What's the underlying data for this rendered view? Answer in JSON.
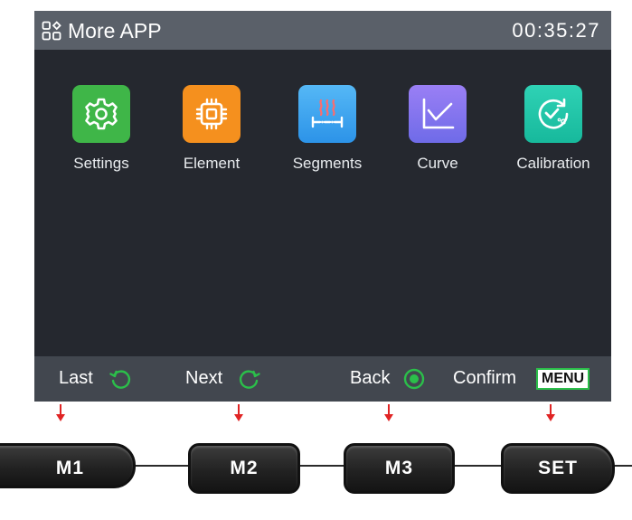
{
  "header": {
    "title": "More APP",
    "clock": "00:35:27",
    "title_icon": "app-grid-icon"
  },
  "apps": [
    {
      "label": "Settings",
      "icon": "gear-icon",
      "color": "#3fb648"
    },
    {
      "label": "Element",
      "icon": "chip-icon",
      "color": "#f5901e"
    },
    {
      "label": "Segments",
      "icon": "heat-segments-icon",
      "color": "#3aa8f2"
    },
    {
      "label": "Curve",
      "icon": "line-chart-icon",
      "color": "#8a6ff0"
    },
    {
      "label": "Calibration",
      "icon": "temperature-calibration-icon",
      "color": "#1fc6a8"
    }
  ],
  "hints": {
    "last": "Last",
    "next": "Next",
    "back": "Back",
    "confirm": "Confirm",
    "menu": "MENU"
  },
  "keys": [
    "M1",
    "M2",
    "M3",
    "SET"
  ],
  "colors": {
    "accent_green": "#2bbf4a",
    "arrow_red": "#e02424",
    "screen_bg": "#25282f",
    "title_bar": "#5a6069",
    "hint_bar": "#42474f"
  }
}
